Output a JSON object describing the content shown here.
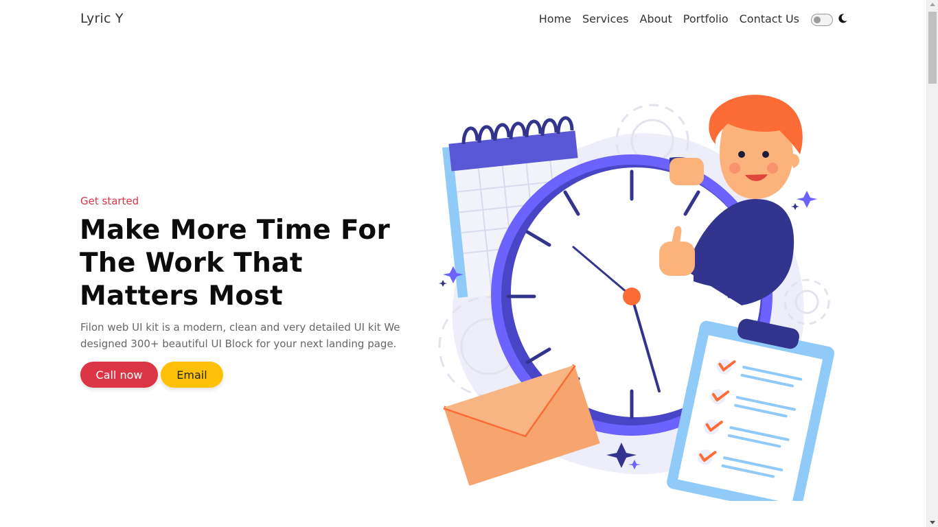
{
  "navbar": {
    "brand": "Lyric Y",
    "links": [
      "Home",
      "Services",
      "About",
      "Portfolio",
      "Contact Us"
    ],
    "theme_toggle": {
      "state": "off",
      "icon": "moon-icon"
    }
  },
  "hero": {
    "eyebrow": "Get started",
    "headline": "Make More Time For The Work That Matters Most",
    "description": "Filon web UI kit is a modern, clean and very detailed UI kit We designed 300+ beautiful UI Block for your next landing page.",
    "buttons": {
      "call": "Call now",
      "email": "Email"
    }
  },
  "colors": {
    "primary_red": "#dc3545",
    "accent_yellow": "#ffc107",
    "clock_purple": "#6c63ff",
    "navy": "#33348e",
    "orange": "#fd6b36",
    "envelope": "#f6a56f",
    "light_blue": "#90caf9"
  },
  "illustration": {
    "icon": "time-management-illustration"
  }
}
